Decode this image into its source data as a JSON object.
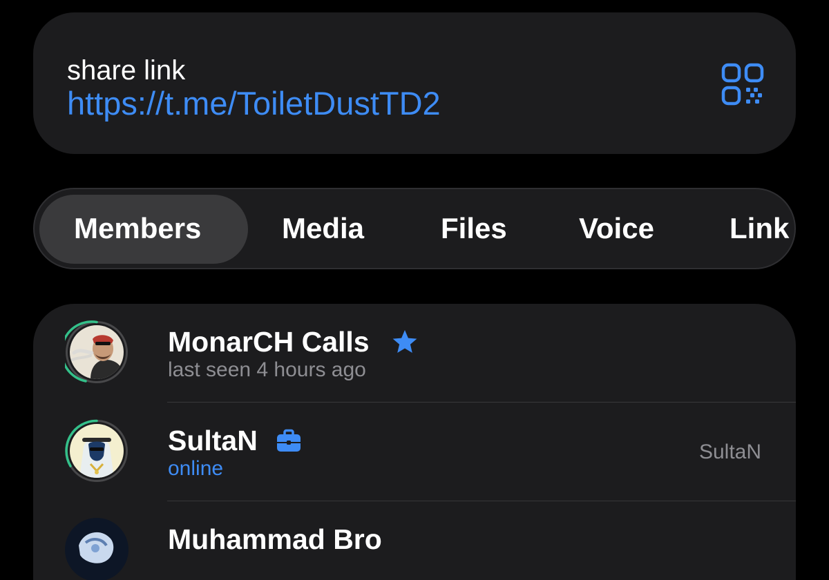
{
  "share": {
    "label": "share link",
    "url": "https://t.me/ToiletDustTD2",
    "qr_icon": "qr-code-icon"
  },
  "tabs": {
    "active": "Members",
    "items": [
      {
        "label": "Members"
      },
      {
        "label": "Media"
      },
      {
        "label": "Files"
      },
      {
        "label": "Voice"
      },
      {
        "label": "Link"
      }
    ]
  },
  "members": [
    {
      "name": "MonarCH Calls",
      "status": "last seen 4 hours ago",
      "badge": "star-icon",
      "role": "",
      "online": false
    },
    {
      "name": "SultaN",
      "status": "online",
      "badge": "briefcase-icon",
      "role": "SultaN",
      "online": true
    },
    {
      "name": "Muhammad Bro",
      "status": "",
      "badge": "",
      "role": "",
      "online": false
    }
  ],
  "colors": {
    "accent": "#3e8cf5",
    "card": "#1c1c1e",
    "background": "#000000",
    "secondary_text": "#8e8e93",
    "story_ring": "#34c08a"
  }
}
